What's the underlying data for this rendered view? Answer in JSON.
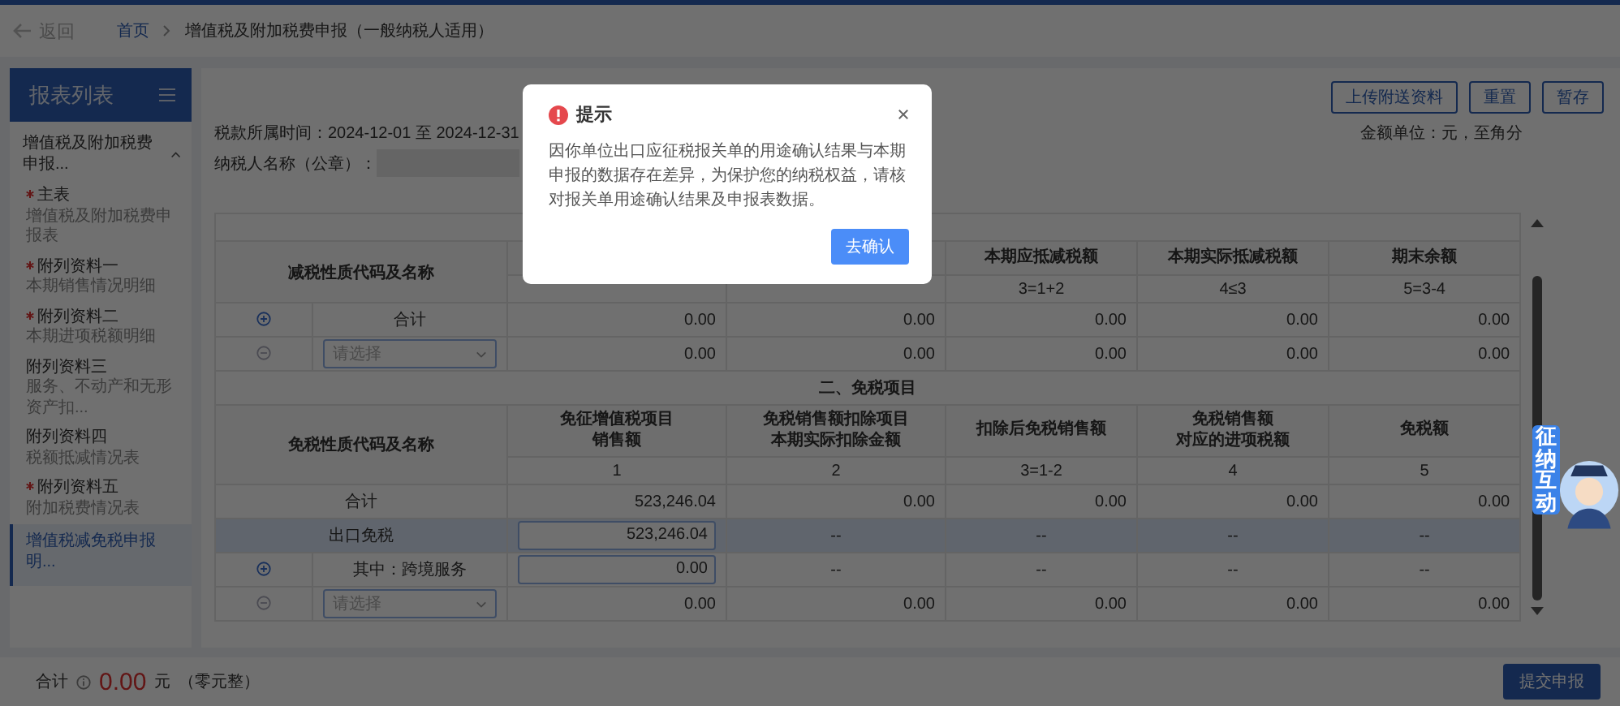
{
  "header": {
    "back": "返回",
    "breadcrumb": [
      {
        "label": "首页",
        "link": true
      },
      {
        "label": "增值税及附加税费申报（一般纳税人适用）",
        "link": false
      }
    ]
  },
  "sidebar": {
    "title": "报表列表",
    "group": {
      "label": "增值税及附加税费申报...",
      "expanded": true
    },
    "items": [
      {
        "title": "主表",
        "subtitle": "增值税及附加税费申报表",
        "required": true,
        "selected": false
      },
      {
        "title": "附列资料一",
        "subtitle": "本期销售情况明细",
        "required": true,
        "selected": false
      },
      {
        "title": "附列资料二",
        "subtitle": "本期进项税额明细",
        "required": true,
        "selected": false
      },
      {
        "title": "附列资料三",
        "subtitle": "服务、不动产和无形资产扣...",
        "required": false,
        "selected": false
      },
      {
        "title": "附列资料四",
        "subtitle": "税额抵减情况表",
        "required": false,
        "selected": false
      },
      {
        "title": "附列资料五",
        "subtitle": "附加税费情况表",
        "required": true,
        "selected": false
      },
      {
        "title": "增值税减免税申报明...",
        "required": false,
        "selected": true
      }
    ]
  },
  "toolbar": {
    "buttons": [
      "上传附送资料",
      "重置",
      "暂存"
    ]
  },
  "info": {
    "period": "税款所属时间：2024-12-01 至 2024-12-31",
    "unit": "金额单位：元，至角分",
    "taxpayer_label": "纳税人名称（公章）："
  },
  "reduction": {
    "code_header": "减税性质代码及名称",
    "columns": [
      {
        "lines": [
          "本期应抵减税额"
        ],
        "index": "3=1+2"
      },
      {
        "lines": [
          "本期实际抵减税额"
        ],
        "index": "4≤3"
      },
      {
        "lines": [
          "期末余额"
        ],
        "index": "5=3-4"
      }
    ],
    "rows": [
      {
        "kind": "total",
        "addable": true,
        "label": "合计",
        "values": [
          "0.00",
          "0.00",
          "0.00",
          "0.00",
          "0.00"
        ]
      },
      {
        "kind": "select",
        "removable": true,
        "placeholder": "请选择",
        "values": [
          "0.00",
          "0.00",
          "0.00",
          "0.00",
          "0.00"
        ]
      }
    ]
  },
  "exemption": {
    "title": "二、免税项目",
    "code_header": "免税性质代码及名称",
    "columns": [
      {
        "lines": [
          "免征增值税项目",
          "销售额"
        ],
        "index": "1"
      },
      {
        "lines": [
          "免税销售额扣除项目",
          "本期实际扣除金额"
        ],
        "index": "2"
      },
      {
        "lines": [
          "扣除后免税销售额"
        ],
        "index": "3=1-2"
      },
      {
        "lines": [
          "免税销售额",
          "对应的进项税额"
        ],
        "index": "4"
      },
      {
        "lines": [
          "免税额"
        ],
        "index": "5"
      }
    ],
    "rows": [
      {
        "kind": "total",
        "label": "合计",
        "selected": false,
        "values": [
          "523,246.04",
          "0.00",
          "0.00",
          "0.00",
          "0.00"
        ]
      },
      {
        "kind": "category",
        "label": "出口免税",
        "selected": true,
        "values": [
          "523,246.04",
          "--",
          "--",
          "--",
          "--"
        ]
      },
      {
        "kind": "sub",
        "addable": true,
        "label": "其中：跨境服务",
        "selected": false,
        "values": [
          "0.00",
          "--",
          "--",
          "--",
          "--"
        ]
      },
      {
        "kind": "select",
        "removable": true,
        "placeholder": "请选择",
        "selected": false,
        "values": [
          "0.00",
          "0.00",
          "0.00",
          "0.00",
          "0.00"
        ]
      }
    ]
  },
  "footer": {
    "label": "合计",
    "amount": "0.00",
    "currency": "元",
    "words": "（零元整）",
    "submit": "提交申报"
  },
  "modal": {
    "title": "提示",
    "message": "因你单位出口应征税报关单的用途确认结果与本期申报的数据存在差异，为保护您的纳税权益，请核对报关单用途确认结果及申报表数据。",
    "confirm": "去确认"
  },
  "mascot": {
    "label": "征纳互动"
  }
}
